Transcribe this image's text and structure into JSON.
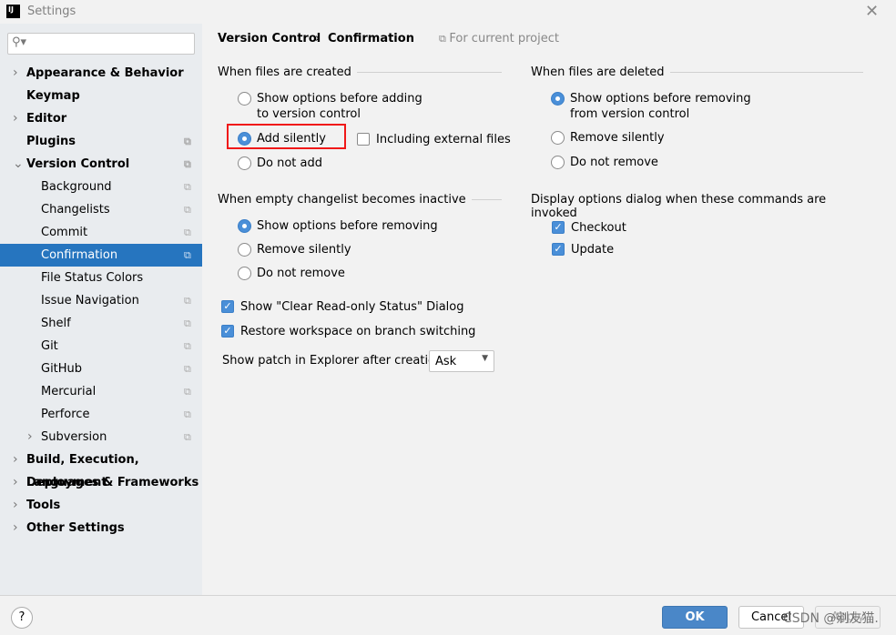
{
  "window": {
    "title": "Settings",
    "logo": "IJ"
  },
  "sidebar": {
    "search_placeholder": "",
    "items": [
      {
        "label": "Appearance & Behavior",
        "level": 0,
        "arrow": "right"
      },
      {
        "label": "Keymap",
        "level": 0
      },
      {
        "label": "Editor",
        "level": 0,
        "arrow": "right"
      },
      {
        "label": "Plugins",
        "level": 0,
        "copy": true
      },
      {
        "label": "Version Control",
        "level": 0,
        "arrow": "down",
        "copy": true
      },
      {
        "label": "Background",
        "level": 1,
        "copy": true
      },
      {
        "label": "Changelists",
        "level": 1,
        "copy": true
      },
      {
        "label": "Commit",
        "level": 1,
        "copy": true
      },
      {
        "label": "Confirmation",
        "level": 1,
        "copy": true,
        "selected": true
      },
      {
        "label": "File Status Colors",
        "level": 1
      },
      {
        "label": "Issue Navigation",
        "level": 1,
        "copy": true
      },
      {
        "label": "Shelf",
        "level": 1,
        "copy": true
      },
      {
        "label": "Git",
        "level": 1,
        "copy": true
      },
      {
        "label": "GitHub",
        "level": 1,
        "copy": true
      },
      {
        "label": "Mercurial",
        "level": 1,
        "copy": true
      },
      {
        "label": "Perforce",
        "level": 1,
        "copy": true
      },
      {
        "label": "Subversion",
        "level": 1,
        "arrow": "right",
        "copy": true
      },
      {
        "label": "Build, Execution, Deployment",
        "level": 0,
        "arrow": "right"
      },
      {
        "label": "Languages & Frameworks",
        "level": 0,
        "arrow": "right"
      },
      {
        "label": "Tools",
        "level": 0,
        "arrow": "right"
      },
      {
        "label": "Other Settings",
        "level": 0,
        "arrow": "right"
      }
    ]
  },
  "breadcrumb": {
    "parent": "Version Control",
    "current": "Confirmation",
    "scope": "For current project"
  },
  "created": {
    "title": "When files are created",
    "opt1": "Show options before adding",
    "opt1b": "to version control",
    "opt2": "Add silently",
    "opt3": "Do not add",
    "external": "Including external files",
    "selected": 2
  },
  "deleted": {
    "title": "When files are deleted",
    "opt1": "Show options before removing",
    "opt1b": "from version control",
    "opt2": "Remove silently",
    "opt3": "Do not remove",
    "selected": 1
  },
  "empty": {
    "title": "When empty changelist becomes inactive",
    "opt1": "Show options before removing",
    "opt2": "Remove silently",
    "opt3": "Do not remove",
    "selected": 1
  },
  "display": {
    "title": "Display options dialog when these commands are invoked",
    "checkout": "Checkout",
    "update": "Update"
  },
  "checks": {
    "readonly": "Show \"Clear Read-only Status\" Dialog",
    "restore": "Restore workspace on branch switching"
  },
  "patch": {
    "label": "Show patch in Explorer after creation:",
    "value": "Ask"
  },
  "footer": {
    "help": "?",
    "ok": "OK",
    "cancel": "Cancel",
    "apply": "Apply",
    "watermark": "CSDN @剜友猫."
  },
  "colors": {
    "accent": "#2675bf",
    "highlight": "#f01818"
  }
}
